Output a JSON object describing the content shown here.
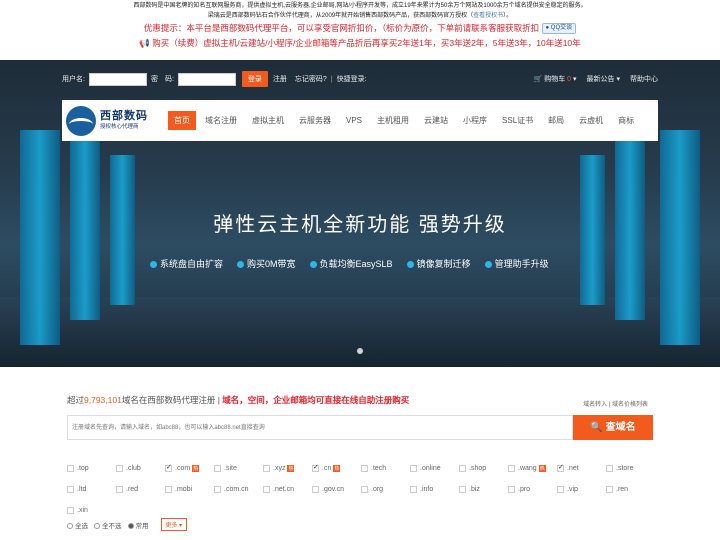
{
  "top": {
    "line1": "西部数码是中国老牌的知名互联网服务商，提供虚拟主机,云服务器,企业邮局,网站/小程序开发等，成立19年来累计为50余万个网站及1000余万个域名提供安全稳定的服务。",
    "line2_pre": "梁璃云是西部数码钻石合作伙伴代理商，从2009年就开始销售西部数码产品，获西部数码官方授权（",
    "line2_link": "查看授权书",
    "line2_post": "）。",
    "notice": "优惠提示：本平台是西部数码代理平台，可以享受官网折扣价，（标价为原价，下单前请联系客服获取折扣",
    "qq_label": "QQ交谈",
    "promo": "购买（续费）虚拟主机/云建站/小程序/企业邮箱等产品折后再享买2年送1年，买3年送2年，5年送3年，10年送10年"
  },
  "login": {
    "user_label": "用户名:",
    "pass_label": "密　码:",
    "login_btn": "登录",
    "register": "注册",
    "forgot": "忘记密码?",
    "quick": "快捷登录:",
    "cart": "购物车",
    "cart_count": "0",
    "news": "最新公告",
    "help": "帮助中心"
  },
  "logo": {
    "name": "西部数码",
    "sub": "授权核心代理商"
  },
  "menu": [
    "首页",
    "域名注册",
    "虚拟主机",
    "云服务器",
    "VPS",
    "主机租用",
    "云建站",
    "小程序",
    "SSL证书",
    "邮局",
    "云虚机",
    "商标"
  ],
  "hero": {
    "title": "弹性云主机全新功能  强势升级",
    "features": [
      "系统盘自由扩容",
      "购买0M带宽",
      "负载均衡EasySLB",
      "镜像复制迁移",
      "管理助手升级"
    ]
  },
  "domain": {
    "promo_pre": "超过",
    "promo_num": "9,793,101",
    "promo_mid": "域名在西部数码代理注册 | ",
    "promo_hl": "域名，空间，企业邮箱均可直接在线自助注册购买",
    "link_transfer": "域名转入",
    "link_price": "域名价格列表",
    "search_placeholder": "注册域名先查询，请输入域名，如abc88，也可以输入abc88.net直接查询",
    "search_btn": "查域名",
    "hot_label": "热",
    "select_all": "全选",
    "select_none": "全不选",
    "common": "常用",
    "more": "更多"
  },
  "tlds": [
    {
      "name": ".top",
      "on": false,
      "hot": false
    },
    {
      "name": ".club",
      "on": false,
      "hot": false
    },
    {
      "name": ".com",
      "on": true,
      "hot": true
    },
    {
      "name": ".site",
      "on": false,
      "hot": false
    },
    {
      "name": ".xyz",
      "on": false,
      "hot": true
    },
    {
      "name": ".cn",
      "on": true,
      "hot": true
    },
    {
      "name": ".tech",
      "on": false,
      "hot": false
    },
    {
      "name": ".online",
      "on": false,
      "hot": false
    },
    {
      "name": ".shop",
      "on": false,
      "hot": false
    },
    {
      "name": ".wang",
      "on": false,
      "hot": true
    },
    {
      "name": ".net",
      "on": true,
      "hot": false
    },
    {
      "name": ".store",
      "on": false,
      "hot": false
    },
    {
      "name": ".ltd",
      "on": false,
      "hot": false
    },
    {
      "name": ".red",
      "on": false,
      "hot": false
    },
    {
      "name": ".mobi",
      "on": false,
      "hot": false
    },
    {
      "name": ".com.cn",
      "on": false,
      "hot": false
    },
    {
      "name": ".net.cn",
      "on": false,
      "hot": false
    },
    {
      "name": ".gov.cn",
      "on": false,
      "hot": false
    },
    {
      "name": ".org",
      "on": false,
      "hot": false
    },
    {
      "name": ".info",
      "on": false,
      "hot": false
    },
    {
      "name": ".biz",
      "on": false,
      "hot": false
    },
    {
      "name": ".pro",
      "on": false,
      "hot": false
    },
    {
      "name": ".vip",
      "on": false,
      "hot": false
    },
    {
      "name": ".ren",
      "on": false,
      "hot": false
    },
    {
      "name": ".xin",
      "on": false,
      "hot": false
    }
  ]
}
